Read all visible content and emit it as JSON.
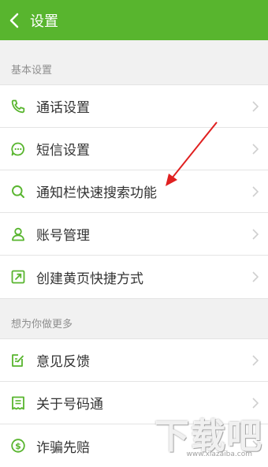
{
  "header": {
    "title": "设置"
  },
  "sections": [
    {
      "label": "基本设置",
      "items": [
        {
          "label": "通话设置",
          "icon": "phone-icon"
        },
        {
          "label": "短信设置",
          "icon": "message-icon"
        },
        {
          "label": "通知栏快速搜索功能",
          "icon": "search-icon"
        },
        {
          "label": "账号管理",
          "icon": "user-icon"
        },
        {
          "label": "创建黄页快捷方式",
          "icon": "shortcut-icon"
        }
      ]
    },
    {
      "label": "想为你做更多",
      "items": [
        {
          "label": "意见反馈",
          "icon": "feedback-icon"
        },
        {
          "label": "关于号码通",
          "icon": "about-icon"
        },
        {
          "label": "诈骗先赔",
          "icon": "compensation-icon"
        }
      ]
    }
  ],
  "watermark": {
    "text": "下载吧",
    "url": "www.xiazaiba.com"
  },
  "colors": {
    "accent": "#58b52e",
    "annotation_arrow": "#e02020"
  }
}
